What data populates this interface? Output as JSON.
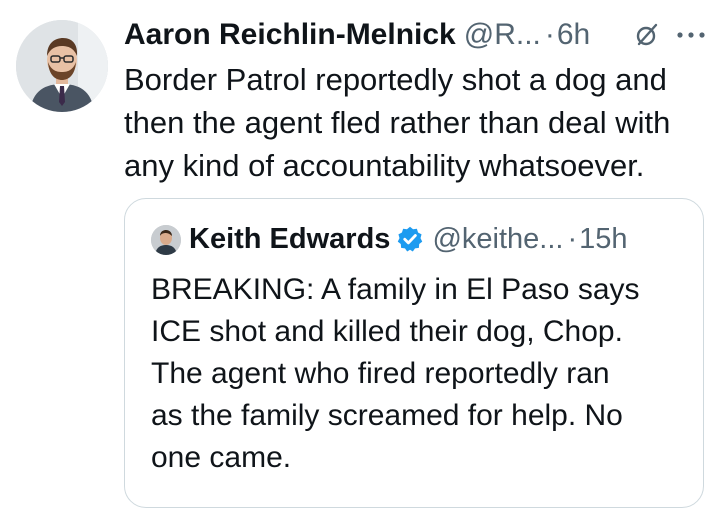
{
  "tweet": {
    "author_name": "Aaron Reichlin-Melnick",
    "handle": "@R...",
    "separator": "·",
    "time": "6h",
    "avatar_icon": "person-avatar-icon",
    "grok_icon": "grok-slash-circle-icon",
    "more_icon": "more-dots-icon",
    "text": "Border Patrol reportedly shot a dog and\nthen the agent fled rather than deal with\nany kind of accountability whatsoever."
  },
  "quote": {
    "author_name": "Keith Edwards",
    "verified_icon": "verified-badge-icon",
    "verified_color": "#1d9bf0",
    "handle": "@keithe...",
    "separator": "·",
    "time": "15h",
    "text": "BREAKING: A family in El Paso says\nICE shot and killed their dog, Chop.\nThe agent who fired reportedly ran\nas the family screamed for help. No\none came."
  }
}
